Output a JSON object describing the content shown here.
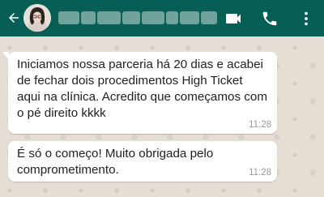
{
  "header": {
    "contact_name": "▇▇▇▇▇▇▇▇▇▇▇▇▇▇▇",
    "colors": {
      "bar": "#075e54",
      "icon": "#ffffff"
    },
    "icons": {
      "back": "arrow-left-icon",
      "video": "videocam-icon",
      "phone": "phone-icon",
      "menu": "more-vert-icon"
    }
  },
  "messages": [
    {
      "text": "Iniciamos nossa parceria há 20 dias e acabei de fechar dois procedimentos High Ticket aqui na clínica. Acredito que começamos com o pé direito kkkk",
      "time": "11:28"
    },
    {
      "text": "É só o começo! Muito obrigada pelo comprometimento.",
      "time": "11:28"
    }
  ],
  "chat": {
    "bubble_color": "#ffffff",
    "wallpaper_color": "#e6ded5"
  }
}
